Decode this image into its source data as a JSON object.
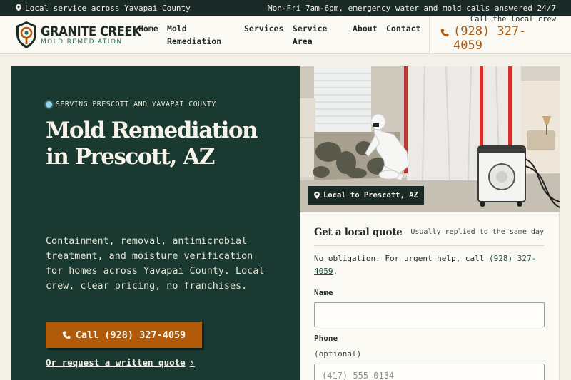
{
  "topbar": {
    "location": "Local service across Yavapai County",
    "hours": "Mon-Fri 7am-6pm, emergency water and mold calls answered 24/7"
  },
  "brand": {
    "name": "GRANITE CREEK",
    "tagline": "MOLD REMEDIATION",
    "colors": {
      "dark_green": "#1a3a31",
      "accent_orange": "#b05a0a",
      "topbar": "#1a2a26"
    }
  },
  "nav": {
    "home": "Home",
    "mold": "Mold Remediation",
    "services": "Services",
    "area": "Service Area",
    "about": "About",
    "contact": "Contact"
  },
  "header_call": {
    "hint": "Call the local crew",
    "phone": "(928) 327-4059",
    "icon": "phone-icon"
  },
  "hero": {
    "eyebrow": "SERVING PRESCOTT AND YAVAPAI COUNTY",
    "title": "Mold Remediation in Prescott, AZ",
    "text": "Containment, removal, antimicrobial treatment, and moisture verification for homes across Yavapai County. Local crew, clear pricing, no franchises.",
    "cta": "Call (928) 327-4059",
    "link": "Or request a written quote"
  },
  "photo": {
    "badge": "Local to Prescott, AZ"
  },
  "quote_form": {
    "title": "Get a local quote",
    "note": "Usually replied to the same day",
    "desc_prefix": "No obligation. For urgent help, call ",
    "desc_phone": "(928) 327-4059",
    "desc_suffix": ".",
    "name_label": "Name",
    "name_value": "",
    "phone_label": "Phone",
    "phone_optional": "(optional)",
    "phone_placeholder": "(417) 555-0134"
  }
}
